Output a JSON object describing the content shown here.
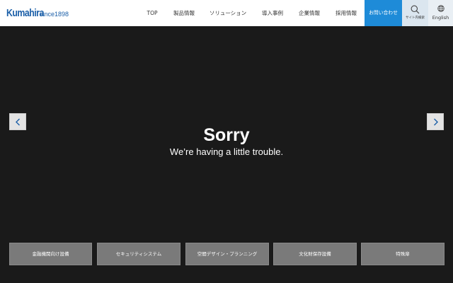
{
  "header": {
    "logo": {
      "name": "Kumahira",
      "since": "since1898"
    },
    "nav": [
      {
        "label": "TOP"
      },
      {
        "label": "製品情報"
      },
      {
        "label": "ソリューション"
      },
      {
        "label": "導入事例"
      },
      {
        "label": "企業情報"
      },
      {
        "label": "採用情報"
      }
    ],
    "contact_label": "お問い合わせ",
    "search_label": "サイト内検索",
    "search_icon": "search-icon",
    "lang_label": "English",
    "lang_icon": "globe-icon",
    "colors": {
      "brand": "#1b5fa8",
      "contact_bg": "#1e8bd8"
    }
  },
  "hero": {
    "title": "Sorry",
    "message": "We’re having a little trouble.",
    "prev_icon": "chevron-left-icon",
    "next_icon": "chevron-right-icon",
    "colors": {
      "background": "#1a1a1a",
      "arrow": "#1b5fa8"
    }
  },
  "categories": [
    {
      "label": "金融機関向け設備"
    },
    {
      "label": "セキュリティシステム"
    },
    {
      "label": "空間デザイン・プランニング"
    },
    {
      "label": "文化財保存設備"
    },
    {
      "label": "特殊扉"
    }
  ]
}
